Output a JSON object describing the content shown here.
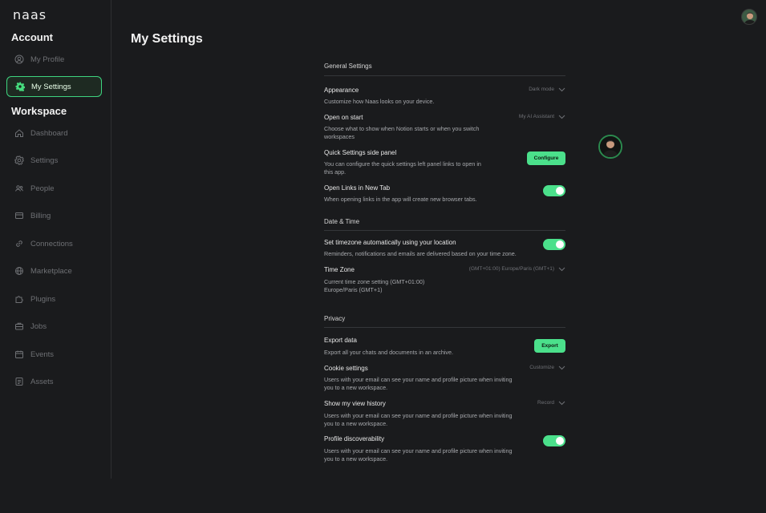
{
  "app": {
    "logo": "naas",
    "page_title": "My Settings"
  },
  "sidebar": {
    "account_title": "Account",
    "workspace_title": "Workspace",
    "account_items": [
      {
        "label": "My Profile",
        "icon": "user-circle-icon"
      },
      {
        "label": "My Settings",
        "icon": "gear-icon",
        "active": true
      }
    ],
    "workspace_items": [
      {
        "label": "Dashboard",
        "icon": "home-icon"
      },
      {
        "label": "Settings",
        "icon": "gear-icon"
      },
      {
        "label": "People",
        "icon": "people-icon"
      },
      {
        "label": "Billing",
        "icon": "credit-card-icon"
      },
      {
        "label": "Connections",
        "icon": "link-icon"
      },
      {
        "label": "Marketplace",
        "icon": "globe-icon"
      },
      {
        "label": "Plugins",
        "icon": "puzzle-icon"
      },
      {
        "label": "Jobs",
        "icon": "briefcase-icon"
      },
      {
        "label": "Events",
        "icon": "calendar-icon"
      },
      {
        "label": "Assets",
        "icon": "file-icon"
      }
    ]
  },
  "settings": {
    "general_title": "General Settings",
    "appearance": {
      "title": "Appearance",
      "desc": "Customize how Naas looks on your device.",
      "value": "Dark mode"
    },
    "open_on_start": {
      "title": "Open on start",
      "desc": "Choose what to show when Notion starts or when you switch workspaces",
      "value": "My AI Assistant"
    },
    "quick_settings": {
      "title": "Quick Settings side panel",
      "desc": "You can configure the quick settings left panel links to open in this app.",
      "button": "Configure"
    },
    "open_links": {
      "title": "Open Links in New Tab",
      "desc": "When opening links in the app will create new browser tabs.",
      "enabled": true
    },
    "datetime_title": "Date & Time",
    "auto_timezone": {
      "title": "Set timezone automatically using your location",
      "desc": "Reminders, notifications and emails are delivered based on your time zone.",
      "enabled": true
    },
    "time_zone": {
      "title": "Time Zone",
      "desc": "Current time zone setting (GMT+01:00) Europe/Paris (GMT+1)",
      "value": "(GMT+01:00) Europe/Paris (GMT+1)"
    },
    "privacy_title": "Privacy",
    "export_data": {
      "title": "Export data",
      "desc": "Export all your chats and documents in an archive.",
      "button": "Export"
    },
    "cookie_settings": {
      "title": "Cookie settings",
      "desc": "Users with your email can see your name and profile picture when inviting you to a new workspace.",
      "value": "Customize"
    },
    "view_history": {
      "title": "Show my view history",
      "desc": "Users with your email can see your name and profile picture when inviting you to a new workspace.",
      "value": "Record"
    },
    "discoverability": {
      "title": "Profile discoverability",
      "desc": "Users with your email can see your name and profile picture when inviting you to a new workspace.",
      "enabled": true
    }
  },
  "colors": {
    "accent": "#4be08b",
    "background": "#1a1b1d"
  }
}
